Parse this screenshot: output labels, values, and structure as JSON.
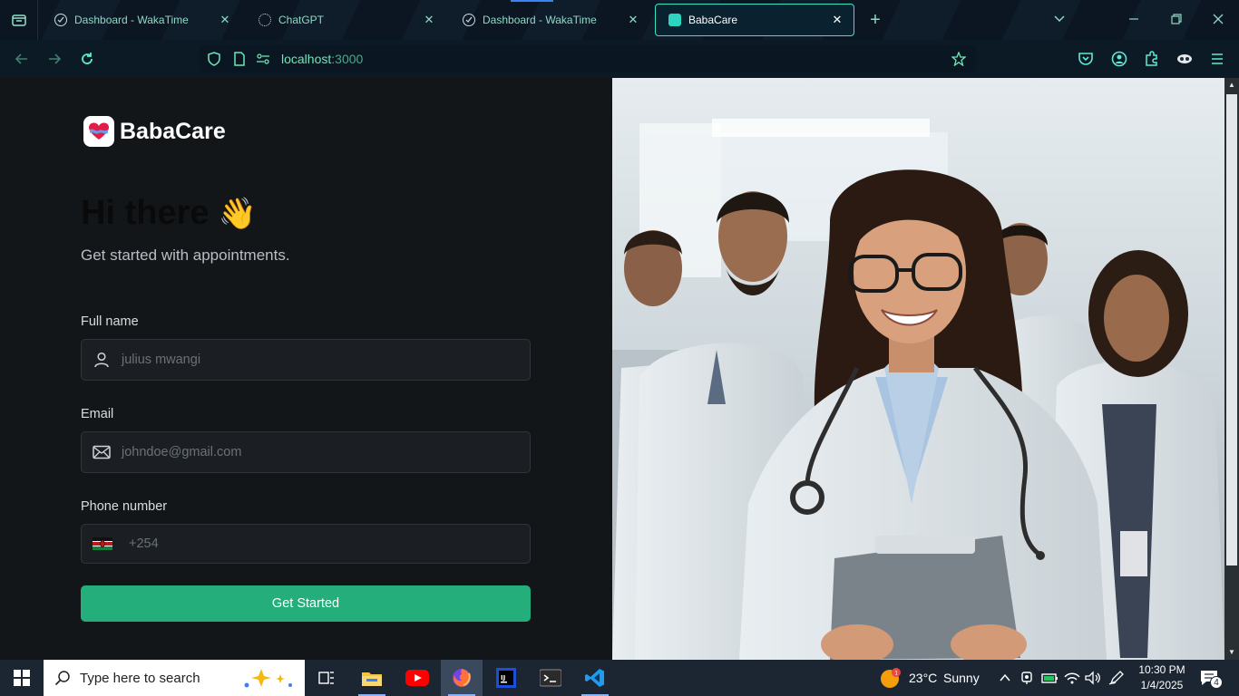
{
  "browser": {
    "tabs": [
      {
        "title": "Dashboard - WakaTime",
        "active": false
      },
      {
        "title": "ChatGPT",
        "active": false
      },
      {
        "title": "Dashboard - WakaTime",
        "active": false
      },
      {
        "title": "BabaCare",
        "active": true
      }
    ],
    "url_host": "localhost",
    "url_port": ":3000"
  },
  "app": {
    "brand": "BabaCare",
    "heading": "Hi there",
    "heading_emoji": "👋",
    "subheading": "Get started with appointments.",
    "form": {
      "name_label": "Full name",
      "name_placeholder": "julius mwangi",
      "email_label": "Email",
      "email_placeholder": "johndoe@gmail.com",
      "phone_label": "Phone number",
      "phone_prefix": "+254",
      "submit_label": "Get Started"
    },
    "colors": {
      "accent": "#24ae7c",
      "panel": "#131619"
    }
  },
  "taskbar": {
    "search_placeholder": "Type here to search",
    "weather_temp": "23°C",
    "weather_desc": "Sunny",
    "time": "10:30 PM",
    "date": "1/4/2025",
    "notification_count": "4"
  }
}
